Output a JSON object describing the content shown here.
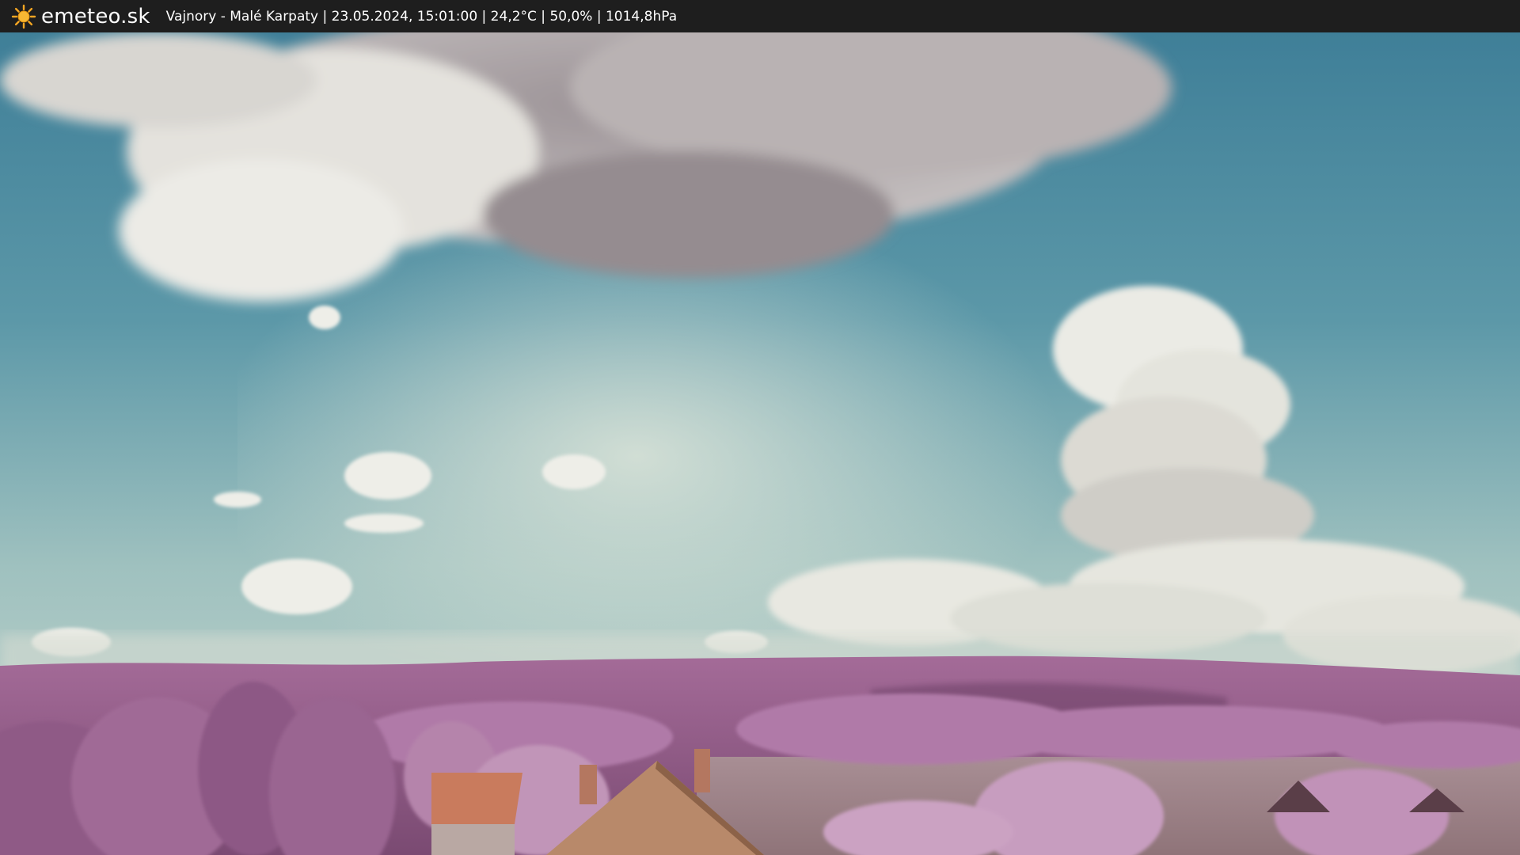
{
  "header": {
    "brand": "emeteo.sk",
    "brand_icon": "sun-icon",
    "caption": "Vajnory - Malé Karpaty | 23.05.2024, 15:01:00 | 24,2°C | 50,0% | 1014,8hPa"
  },
  "colors": {
    "bar_background": "#1e1e1e",
    "bar_text": "#ffffff",
    "sun": "#f5a623"
  }
}
